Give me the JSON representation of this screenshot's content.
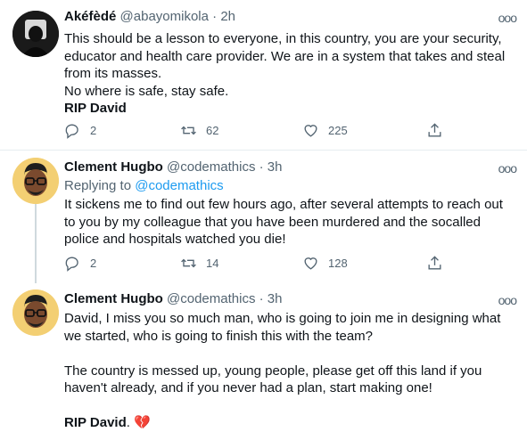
{
  "tweets": [
    {
      "name": "Akéfèdé",
      "handle": "@abayomikola",
      "time": "· 2h",
      "lines": [
        "This should be a lesson to everyone, in this country, you are your security,",
        "educator and health care provider. We are in a system that takes and steal",
        "from its masses.",
        "No where is safe, stay safe."
      ],
      "signoff": "RIP David",
      "replies": "2",
      "retweets": "62",
      "likes": "225",
      "avatar_icon": "dark-silhouette-avatar"
    },
    {
      "name": "Clement Hugbo",
      "handle": "@codemathics",
      "time": "· 3h",
      "replying_prefix": "Replying to",
      "replying_to": "@codemathics",
      "lines": [
        "It sickens me to find out few hours ago, after several attempts to reach out",
        "to you by my colleague that you have been murdered and the socalled",
        "police and hospitals watched you die!"
      ],
      "replies": "2",
      "retweets": "14",
      "likes": "128",
      "avatar_icon": "cartoon-glasses-avatar"
    },
    {
      "name": "Clement Hugbo",
      "handle": "@codemathics",
      "time": "· 3h",
      "lines": [
        "David, I miss you so much man, who is going to join me in designing what",
        "we started, who is going to finish this with the team?"
      ],
      "lines2": [
        "The country is messed up, young people, please get off this land if you",
        "haven't already, and if you never had a plan, start making one!"
      ],
      "signoff": "RIP David",
      "signoff_suffix": ".",
      "emoji": "💔",
      "avatar_icon": "cartoon-glasses-avatar"
    }
  ],
  "more_glyph": "ooo",
  "colors": {
    "text": "#0f1419",
    "muted": "#536471",
    "link": "#1d9bf0",
    "divider": "#e6ecf0",
    "thread": "#cfd9de"
  },
  "icons": [
    "reply-icon",
    "retweet-icon",
    "like-icon",
    "share-icon",
    "more-icon"
  ]
}
